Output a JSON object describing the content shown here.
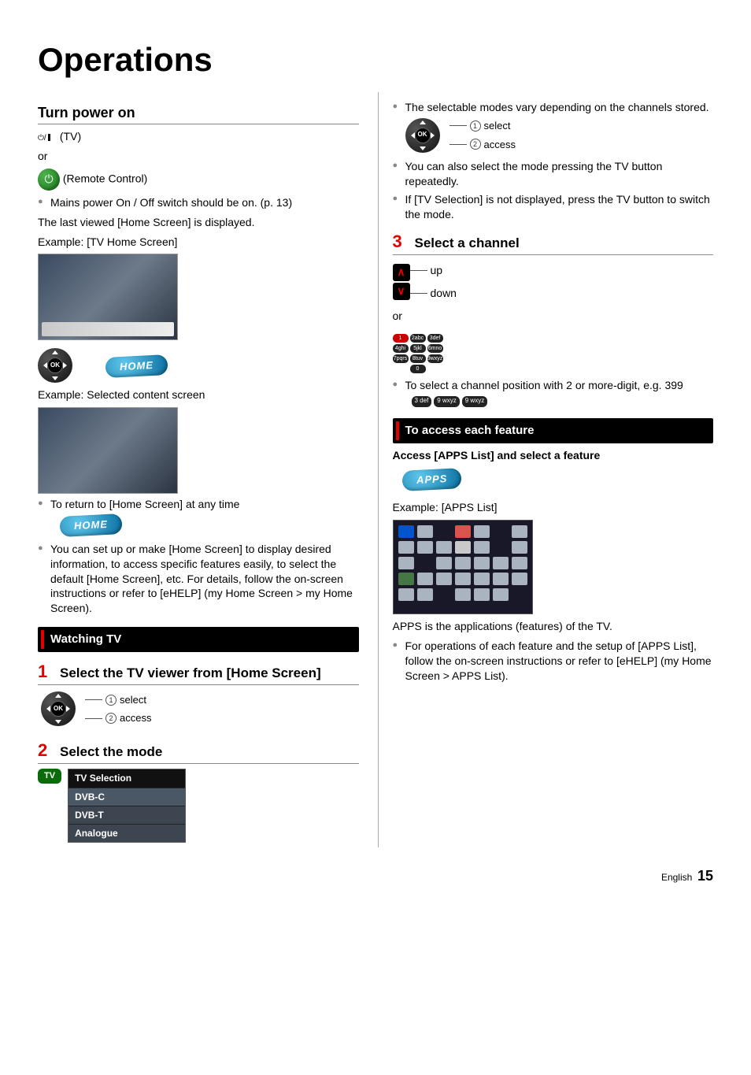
{
  "page_title": "Operations",
  "left": {
    "turn_power_on": {
      "heading": "Turn power on",
      "tv_label": "(TV)",
      "or": "or",
      "remote_label": "(Remote Control)",
      "bullet_mains": "Mains power On / Off switch should be on. (p. 13)",
      "last_viewed": "The last viewed [Home Screen] is displayed.",
      "example_tvhome": "Example: [TV Home Screen]",
      "home_btn": "HOME",
      "example_selected": "Example: Selected content screen",
      "bullet_return": "To return to [Home Screen] at any time",
      "bullet_setup": "You can set up or make [Home Screen] to display desired information, to access specific features easily, to select the default [Home Screen], etc. For details, follow the on-screen instructions or refer to [eHELP] (my Home Screen > my Home Screen)."
    },
    "watching_tv": {
      "heading": "Watching TV",
      "step1_label": "Select the TV viewer from [Home Screen]",
      "annot_select": "select",
      "annot_access": "access",
      "step2_label": "Select the mode",
      "tv_btn": "TV",
      "tvsel_title": "TV Selection",
      "tvsel_options": [
        "DVB-C",
        "DVB-T",
        "Analogue"
      ]
    }
  },
  "right": {
    "mode_notes": {
      "bullet_vary": "The selectable modes vary depending on the channels stored.",
      "annot_select": "select",
      "annot_access": "access",
      "bullet_also": "You can also select the mode pressing the TV button repeatedly.",
      "bullet_notdisplayed": "If [TV Selection] is not displayed, press the TV button to switch the mode."
    },
    "step3": {
      "label": "Select a channel",
      "up": "up",
      "down": "down",
      "or": "or",
      "bullet_multi": "To select a channel position with 2 or more-digit, e.g. 399",
      "keys_example": [
        "3 def",
        "9 wxyz",
        "9 wxyz"
      ]
    },
    "access_feature": {
      "heading": "To access each feature",
      "sub": "Access [APPS List] and select a feature",
      "apps_btn": "APPS",
      "example_apps": "Example: [APPS List]",
      "desc": "APPS is the applications (features) of the TV.",
      "bullet_ops": "For operations of each feature and the setup of [APPS List], follow the on-screen instructions or refer to [eHELP] (my Home Screen > APPS List)."
    }
  },
  "footer": {
    "lang": "English",
    "page": "15"
  },
  "keypad_keys": [
    "1",
    "2abc",
    "3def",
    "4ghi",
    "5jkl",
    "6mno",
    "7pqrs",
    "8tuv",
    "9wxyz",
    "",
    "0",
    ""
  ]
}
